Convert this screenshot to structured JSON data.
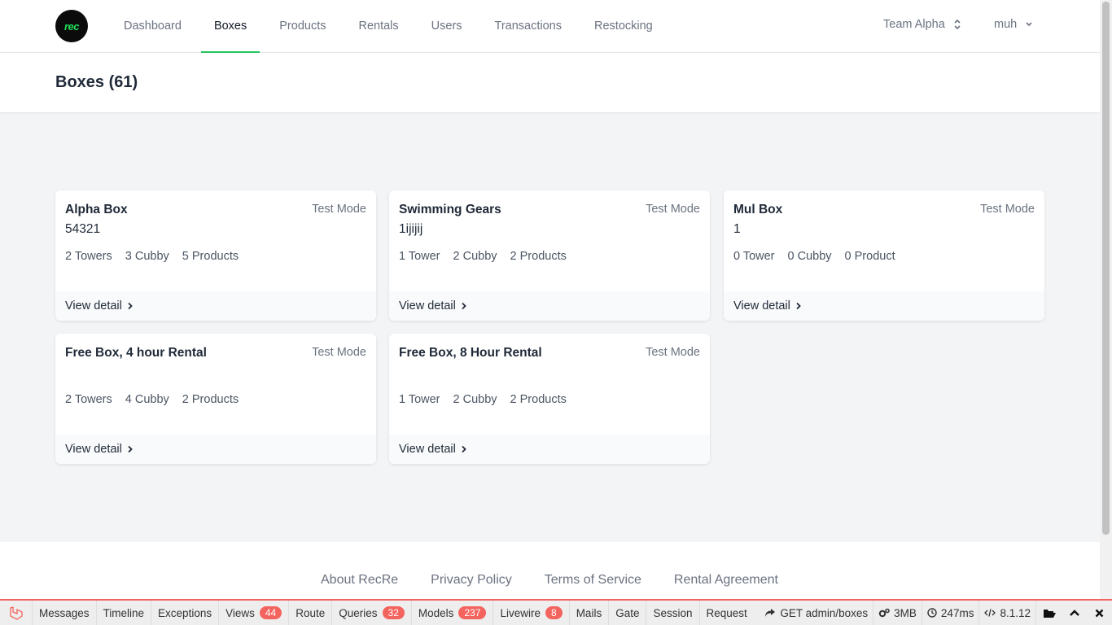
{
  "nav": {
    "logo_text": "rec",
    "links": [
      "Dashboard",
      "Boxes",
      "Products",
      "Rentals",
      "Users",
      "Transactions",
      "Restocking"
    ],
    "active": "Boxes",
    "team": "Team Alpha",
    "user": "muh"
  },
  "page": {
    "title": "Boxes (61)"
  },
  "cards": [
    {
      "title": "Alpha Box",
      "mode": "Test Mode",
      "code": "54321",
      "towers": "2 Towers",
      "cubby": "3 Cubby",
      "products": "5 Products",
      "link": "View detail"
    },
    {
      "title": "Swimming Gears",
      "mode": "Test Mode",
      "code": "1ijijij",
      "towers": "1 Tower",
      "cubby": "2 Cubby",
      "products": "2 Products",
      "link": "View detail"
    },
    {
      "title": "Mul Box",
      "mode": "Test Mode",
      "code": "1",
      "towers": "0 Tower",
      "cubby": "0 Cubby",
      "products": "0 Product",
      "link": "View detail"
    },
    {
      "title": "Free Box, 4 hour Rental",
      "mode": "Test Mode",
      "code": "",
      "towers": "2 Towers",
      "cubby": "4 Cubby",
      "products": "2 Products",
      "link": "View detail"
    },
    {
      "title": "Free Box, 8 Hour Rental",
      "mode": "Test Mode",
      "code": "",
      "towers": "1 Tower",
      "cubby": "2 Cubby",
      "products": "2 Products",
      "link": "View detail"
    }
  ],
  "footer": {
    "links": [
      "About RecRe",
      "Privacy Policy",
      "Terms of Service",
      "Rental Agreement"
    ]
  },
  "debugbar": {
    "tabs": [
      {
        "label": "Messages",
        "badge": ""
      },
      {
        "label": "Timeline",
        "badge": ""
      },
      {
        "label": "Exceptions",
        "badge": ""
      },
      {
        "label": "Views",
        "badge": "44"
      },
      {
        "label": "Route",
        "badge": ""
      },
      {
        "label": "Queries",
        "badge": "32"
      },
      {
        "label": "Models",
        "badge": "237"
      },
      {
        "label": "Livewire",
        "badge": "8"
      },
      {
        "label": "Mails",
        "badge": ""
      },
      {
        "label": "Gate",
        "badge": ""
      },
      {
        "label": "Session",
        "badge": ""
      },
      {
        "label": "Request",
        "badge": ""
      }
    ],
    "request": "GET admin/boxes",
    "memory": "3MB",
    "time": "247ms",
    "php": "8.1.12"
  },
  "colors": {
    "accent": "#22c55e",
    "debug_red": "#f4645f",
    "logo_green": "#22e05a"
  }
}
